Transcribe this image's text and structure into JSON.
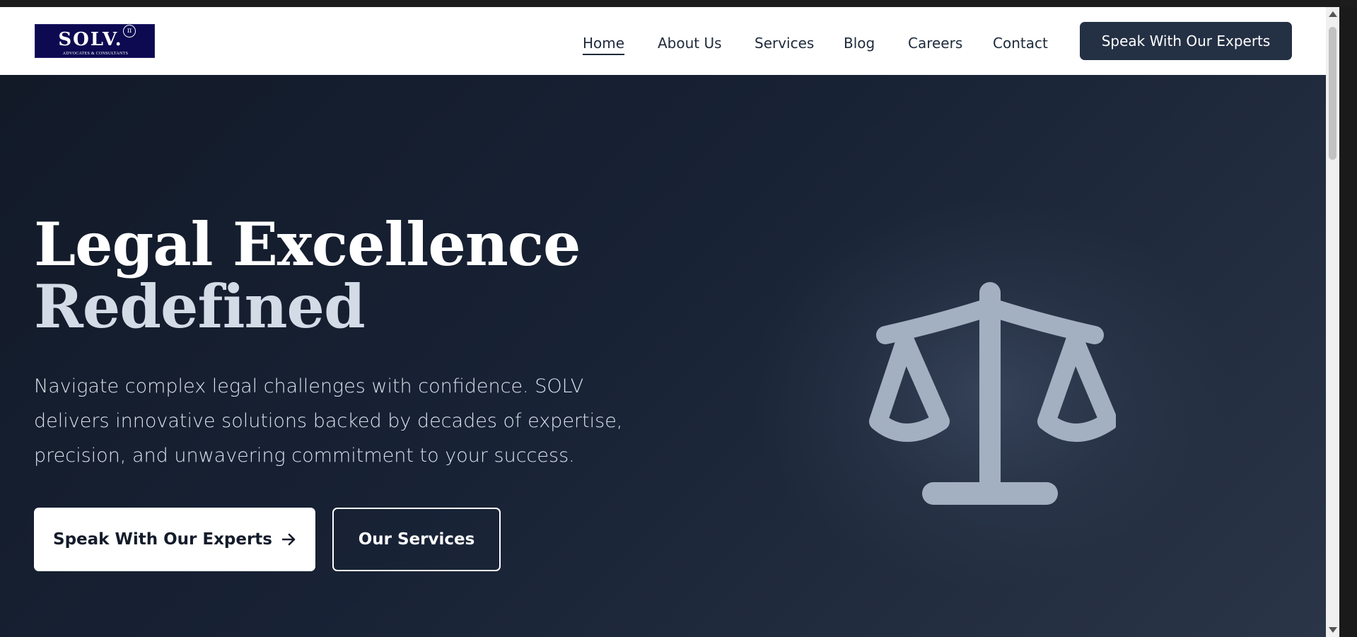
{
  "brand": {
    "logo_text": "SOLV.",
    "logo_subtitle": "ADVOCATES & CONSULTANTS",
    "logo_mark": "π",
    "logo_bg": "#0d0a52"
  },
  "nav": {
    "items": [
      {
        "label": "Home",
        "active": true
      },
      {
        "label": "About Us",
        "active": false
      },
      {
        "label": "Services",
        "active": false
      },
      {
        "label": "Blog",
        "active": false
      },
      {
        "label": "Careers",
        "active": false
      },
      {
        "label": "Contact",
        "active": false
      }
    ],
    "cta_label": "Speak With Our Experts"
  },
  "hero": {
    "title_line1": "Legal Excellence",
    "title_line2": "Redefined",
    "description": "Navigate complex legal challenges with confidence. SOLV delivers innovative solutions backed by decades of expertise, precision, and unwavering commitment to your success.",
    "primary_button": "Speak With Our Experts",
    "primary_button_icon": "arrow-right-icon",
    "secondary_button": "Our Services",
    "illustration_icon": "scales-of-justice-icon"
  },
  "colors": {
    "accent": "#243044",
    "hero_bg": "#182235",
    "illustration": "#a3b0c2"
  }
}
